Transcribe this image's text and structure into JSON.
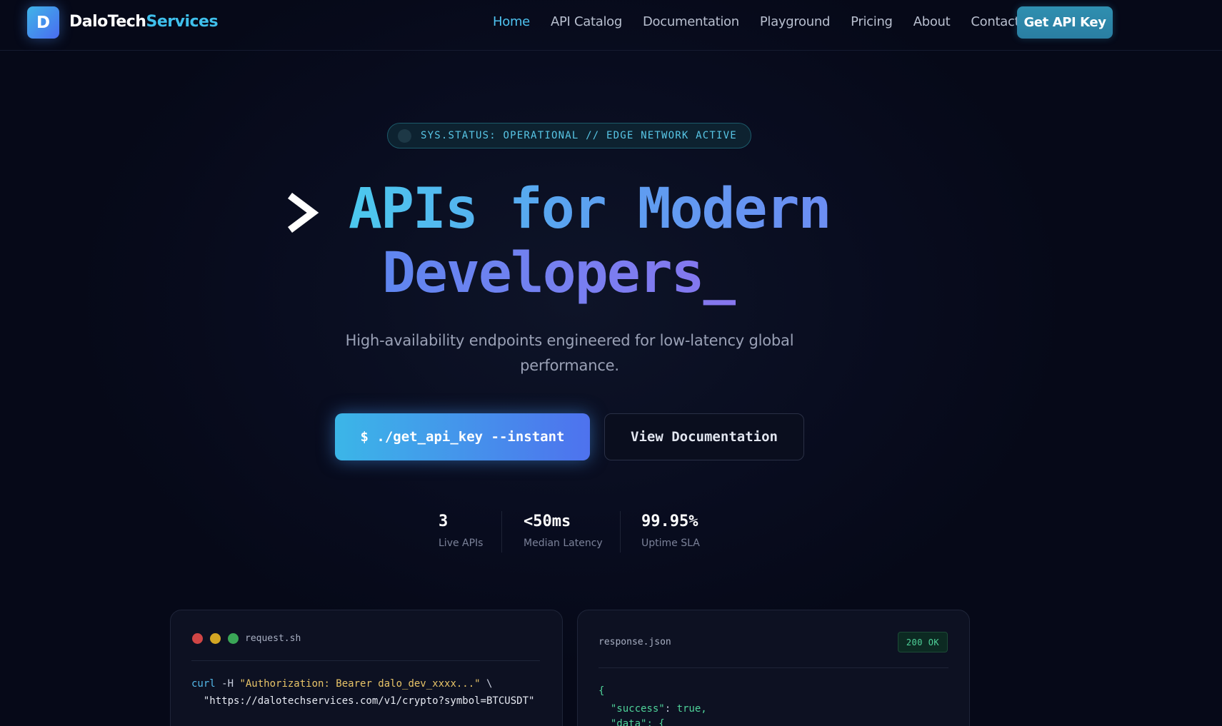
{
  "nav": {
    "logo_letter": "D",
    "brand_part1": "DaloTech",
    "brand_part2": "Services",
    "links": [
      "Home",
      "API Catalog",
      "Documentation",
      "Playground",
      "Pricing",
      "About",
      "Contact"
    ],
    "active_link": "Home",
    "cta_label": "Get API Key"
  },
  "status": {
    "text": "SYS.STATUS: OPERATIONAL // EDGE NETWORK ACTIVE"
  },
  "hero": {
    "line1": "APIs for Modern",
    "line2": "Developers_",
    "subtitle": "High-availability endpoints engineered for low-latency global performance.",
    "primary_button": "$ ./get_api_key --instant",
    "secondary_button": "View Documentation"
  },
  "stats": [
    {
      "value": "3",
      "label": "Live APIs"
    },
    {
      "value": "<50ms",
      "label": "Median Latency"
    },
    {
      "value": "99.95%",
      "label": "Uptime SLA"
    }
  ],
  "request_card": {
    "filename": "request.sh",
    "code_cmd": "curl",
    "code_flag": " -H ",
    "code_header": "\"Authorization: Bearer dalo_dev_xxxx...\"",
    "code_continuation": " \\",
    "code_url": "  \"https://dalotechservices.com/v1/crypto?symbol=BTCUSDT\""
  },
  "response_card": {
    "filename": "response.json",
    "status_badge": "200 OK",
    "line1": "{",
    "line2_key": "  \"success\"",
    "line2_sep": ": ",
    "line2_val": "true,",
    "line3_key": "  \"data\"",
    "line3_rest": ": {"
  },
  "colors": {
    "accent_cyan": "#4ec2ef",
    "accent_blue": "#4e72ee",
    "background": "#070a1a",
    "success_green": "#4fd39a"
  }
}
